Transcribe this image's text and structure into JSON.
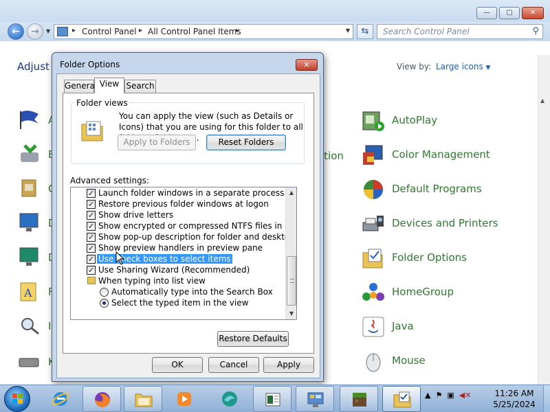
{
  "explorer": {
    "breadcrumbs": [
      "Control Panel",
      "All Control Panel Items"
    ],
    "search_placeholder": "Search Control Panel",
    "adjust_text": "Adjust y",
    "view_by_label": "View by:",
    "view_by_value": "Large icons",
    "partial_item_text": "otion",
    "left_letters": [
      "A",
      "B",
      "C",
      "D",
      "D",
      "F",
      "I",
      "K"
    ],
    "items": [
      {
        "label": "AutoPlay",
        "icon": "autoplay-icon"
      },
      {
        "label": "Color Management",
        "icon": "color-management-icon"
      },
      {
        "label": "Default Programs",
        "icon": "default-programs-icon"
      },
      {
        "label": "Devices and Printers",
        "icon": "devices-printers-icon"
      },
      {
        "label": "Folder Options",
        "icon": "folder-options-icon"
      },
      {
        "label": "HomeGroup",
        "icon": "homegroup-icon"
      },
      {
        "label": "Java",
        "icon": "java-icon"
      },
      {
        "label": "Mouse",
        "icon": "mouse-icon"
      }
    ]
  },
  "dialog": {
    "title": "Folder Options",
    "tabs": [
      "General",
      "View",
      "Search"
    ],
    "active_tab": "View",
    "folder_views_label": "Folder views",
    "folder_views_desc": "You can apply the view (such as Details or Icons) that you are using for this folder to all folders of this type.",
    "apply_button": "Apply to Folders",
    "reset_button": "Reset Folders",
    "advanced_label": "Advanced settings:",
    "settings": [
      {
        "type": "checkbox",
        "label": "Launch folder windows in a separate process",
        "checked": true,
        "indent": 0
      },
      {
        "type": "checkbox",
        "label": "Restore previous folder windows at logon",
        "checked": true,
        "indent": 0
      },
      {
        "type": "checkbox",
        "label": "Show drive letters",
        "checked": true,
        "indent": 0
      },
      {
        "type": "checkbox",
        "label": "Show encrypted or compressed NTFS files in color",
        "checked": true,
        "indent": 0
      },
      {
        "type": "checkbox",
        "label": "Show pop-up description for folder and desktop items",
        "checked": true,
        "indent": 0
      },
      {
        "type": "checkbox",
        "label": "Show preview handlers in preview pane",
        "checked": true,
        "indent": 0
      },
      {
        "type": "checkbox",
        "label": "Use check boxes to select items",
        "checked": true,
        "indent": 0,
        "selected": true
      },
      {
        "type": "checkbox",
        "label": "Use Sharing Wizard (Recommended)",
        "checked": true,
        "indent": 0
      },
      {
        "type": "folder",
        "label": "When typing into list view",
        "indent": 0
      },
      {
        "type": "radio",
        "label": "Automatically type into the Search Box",
        "checked": false,
        "indent": 1
      },
      {
        "type": "radio",
        "label": "Select the typed item in the view",
        "checked": true,
        "indent": 1
      }
    ],
    "restore_defaults": "Restore Defaults",
    "ok": "OK",
    "cancel": "Cancel",
    "apply": "Apply"
  },
  "taskbar": {
    "apps": [
      "internet-explorer-icon",
      "firefox-icon",
      "file-explorer-icon",
      "media-player-icon",
      "edge-like-icon",
      "notepad-icon",
      "control-panel-icon",
      "minecraft-icon",
      "folder-options-icon"
    ],
    "time": "11:26 AM",
    "date": "5/25/2024"
  }
}
